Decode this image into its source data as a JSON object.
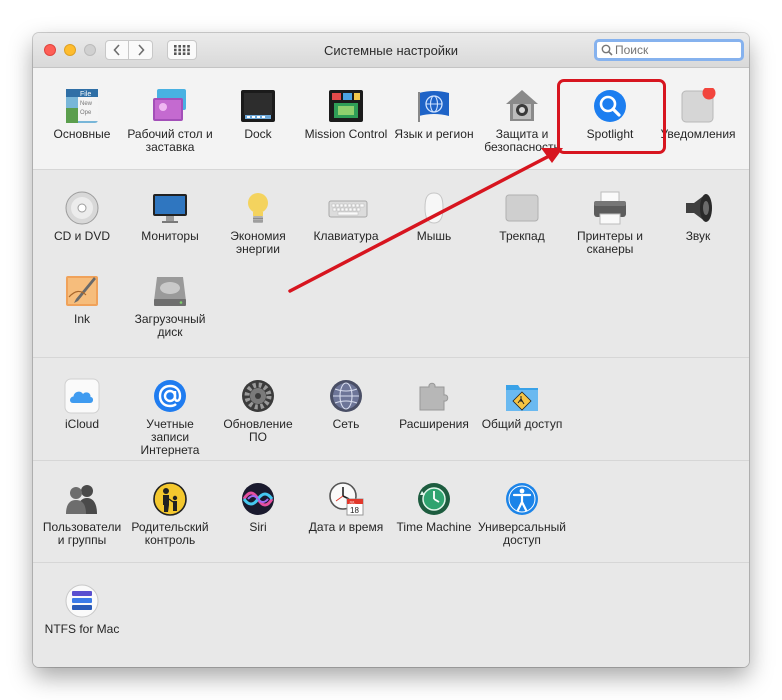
{
  "window": {
    "title": "Системные настройки",
    "search": {
      "placeholder": "Поиск",
      "value": ""
    }
  },
  "sections": [
    {
      "panes": [
        {
          "label": "Основные"
        },
        {
          "label": "Рабочий стол и заставка"
        },
        {
          "label": "Dock"
        },
        {
          "label": "Mission Control"
        },
        {
          "label": "Язык и регион"
        },
        {
          "label": "Защита и безопасность"
        },
        {
          "label": "Spotlight"
        },
        {
          "label": "Уведомления"
        }
      ]
    },
    {
      "panes": [
        {
          "label": "CD и DVD"
        },
        {
          "label": "Мониторы"
        },
        {
          "label": "Экономия энергии"
        },
        {
          "label": "Клавиатура"
        },
        {
          "label": "Мышь"
        },
        {
          "label": "Трекпад"
        },
        {
          "label": "Принтеры и сканеры"
        },
        {
          "label": "Звук"
        },
        {
          "label": "Ink"
        },
        {
          "label": "Загрузочный диск"
        }
      ]
    },
    {
      "panes": [
        {
          "label": "iCloud"
        },
        {
          "label": "Учетные записи Интернета"
        },
        {
          "label": "Обновление ПО"
        },
        {
          "label": "Сеть"
        },
        {
          "label": "Расширения"
        },
        {
          "label": "Общий доступ"
        }
      ]
    },
    {
      "panes": [
        {
          "label": "Пользователи и группы"
        },
        {
          "label": "Родительский контроль"
        },
        {
          "label": "Siri"
        },
        {
          "label": "Дата и время"
        },
        {
          "label": "Time Machine"
        },
        {
          "label": "Универсальный доступ"
        }
      ]
    },
    {
      "panes": [
        {
          "label": "NTFS for Mac"
        }
      ]
    }
  ],
  "icons": {
    "general_file_text": "File",
    "general_new_text": "New",
    "general_ope_text": "Ope",
    "calendar_month": "JUL",
    "calendar_day": "18"
  },
  "colors": {
    "annotation": "#d7151f",
    "accent": "#1c7ef0",
    "notification_badge": "#f2453d"
  }
}
